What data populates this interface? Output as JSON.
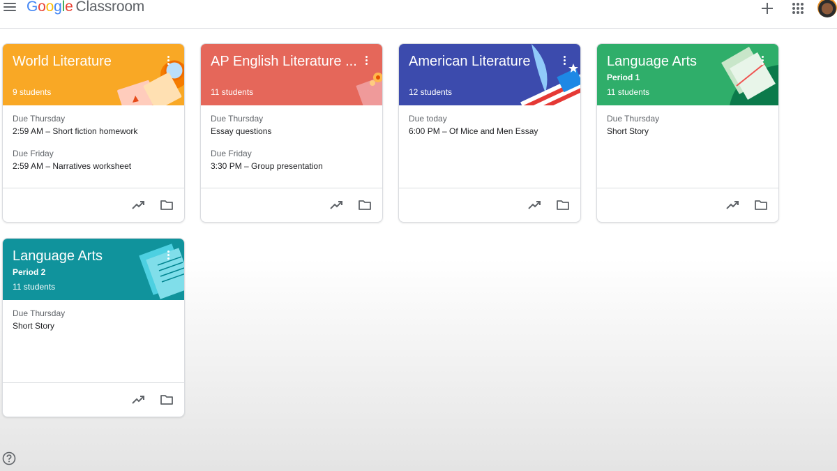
{
  "app": {
    "brand": [
      "G",
      "o",
      "o",
      "g",
      "l",
      "e"
    ],
    "product": "Classroom"
  },
  "icons": {
    "menu": "menu-icon",
    "create": "plus-icon",
    "apps": "apps-grid-icon",
    "account": "avatar",
    "trend": "trending-up-icon",
    "folder": "folder-icon",
    "more": "more-vert-icon",
    "help": "help-icon"
  },
  "cards": [
    {
      "title": "World Literature",
      "section": "",
      "students": "9 students",
      "color": "#f9a825",
      "assignments": [
        {
          "due": "Due Thursday",
          "item": "2:59 AM – Short fiction homework"
        },
        {
          "due": "Due Friday",
          "item": "2:59 AM – Narratives worksheet"
        }
      ]
    },
    {
      "title": "AP English Literature ...",
      "section": "",
      "students": "11 students",
      "color": "#e5675a",
      "assignments": [
        {
          "due": "Due Thursday",
          "item": "Essay questions"
        },
        {
          "due": "Due Friday",
          "item": "3:30 PM – Group presentation"
        }
      ]
    },
    {
      "title": "American Literature",
      "section": "",
      "students": "12 students",
      "color": "#3c4bad",
      "assignments": [
        {
          "due": "Due today",
          "item": "6:00 PM – Of Mice and Men Essay"
        }
      ]
    },
    {
      "title": "Language Arts",
      "section": "Period 1",
      "students": "11 students",
      "color": "#2fae6a",
      "assignments": [
        {
          "due": "Due Thursday",
          "item": "Short Story"
        }
      ]
    },
    {
      "title": "Language Arts",
      "section": "Period 2",
      "students": "11 students",
      "color": "#10939c",
      "assignments": [
        {
          "due": "Due Thursday",
          "item": "Short Story"
        }
      ]
    }
  ]
}
